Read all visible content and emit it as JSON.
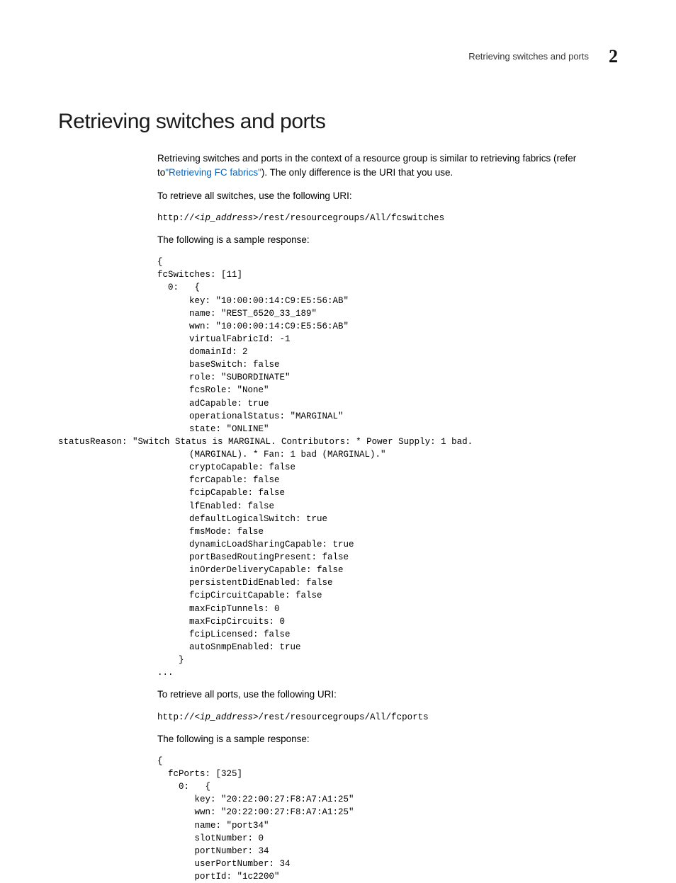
{
  "running_head": {
    "title": "Retrieving switches and ports",
    "chapter_number": "2"
  },
  "h1": "Retrieving switches and ports",
  "body": {
    "p1_pre": "Retrieving switches and ports in the context of a resource group is similar to retrieving fabrics (refer to",
    "p1_link": "\"Retrieving FC fabrics\"",
    "p1_post": "). The only difference is the URI that you use.",
    "p2": "To retrieve all switches, use the following URI:",
    "uri1_pre": "http://",
    "uri1_var": "<ip_address>",
    "uri1_post": "/rest/resourcegroups/All/fcswitches",
    "p3": "The following is a sample response:",
    "code1a": "{\nfcSwitches: [11]\n  0:   {\n      key: \"10:00:00:14:C9:E5:56:AB\"\n      name: \"REST_6520_33_189\"\n      wwn: \"10:00:00:14:C9:E5:56:AB\"\n      virtualFabricId: -1\n      domainId: 2\n      baseSwitch: false\n      role: \"SUBORDINATE\"\n      fcsRole: \"None\"\n      adCapable: true\n      operationalStatus: \"MARGINAL\"\n      state: \"ONLINE\"",
    "code1_status": "statusReason: \"Switch Status is MARGINAL. Contributors: * Power Supply: 1 bad. ",
    "code1b": "      (MARGINAL). * Fan: 1 bad (MARGINAL).\"\n      cryptoCapable: false\n      fcrCapable: false\n      fcipCapable: false\n      lfEnabled: false\n      defaultLogicalSwitch: true\n      fmsMode: false\n      dynamicLoadSharingCapable: true\n      portBasedRoutingPresent: false\n      inOrderDeliveryCapable: false\n      persistentDidEnabled: false\n      fcipCircuitCapable: false\n      maxFcipTunnels: 0\n      maxFcipCircuits: 0\n      fcipLicensed: false\n      autoSnmpEnabled: true\n    }\n...",
    "p4": "To retrieve all ports, use the following URI:",
    "uri2_pre": "http://",
    "uri2_var": "<ip_address>",
    "uri2_post": "/rest/resourcegroups/All/fcports",
    "p5": "The following is a sample response:",
    "code2": "{\n  fcPorts: [325]\n    0:   {\n       key: \"20:22:00:27:F8:A7:A1:25\"\n       wwn: \"20:22:00:27:F8:A7:A1:25\"\n       name: \"port34\"\n       slotNumber: 0\n       portNumber: 34\n       userPortNumber: 34\n       portId: \"1c2200\""
  }
}
